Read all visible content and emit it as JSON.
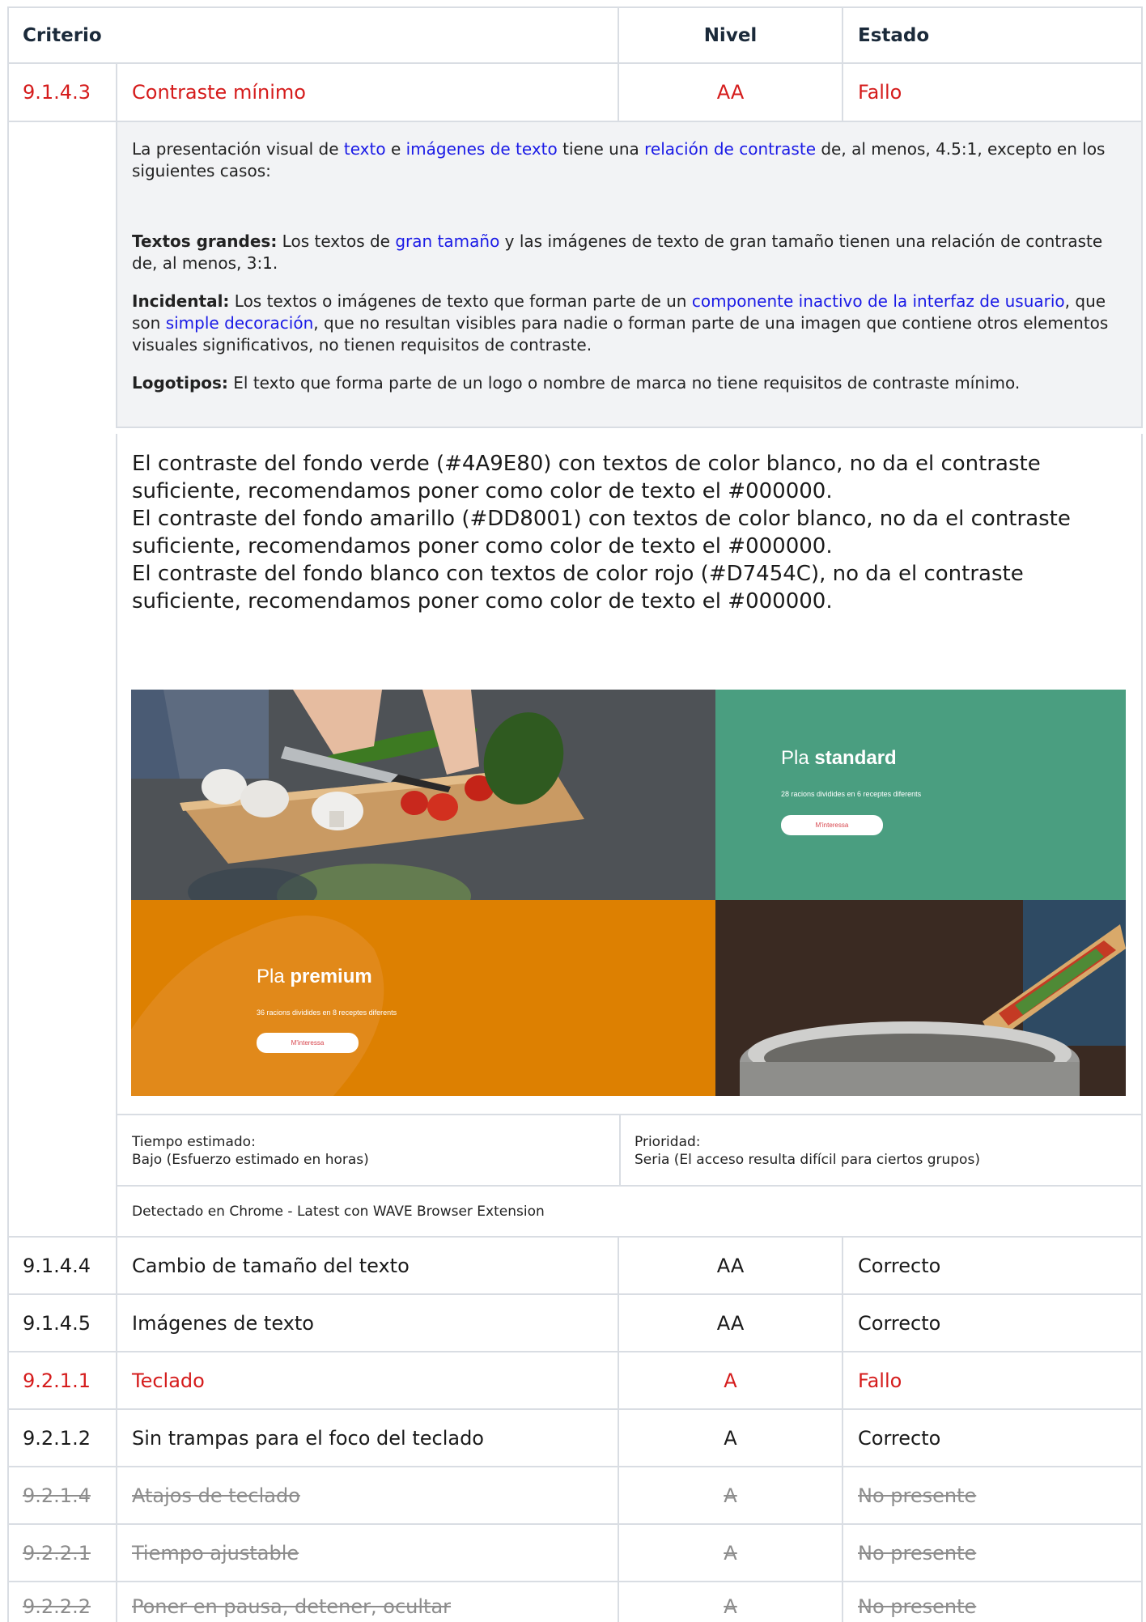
{
  "header": {
    "criterio": "Criterio",
    "nivel": "Nivel",
    "estado": "Estado"
  },
  "expanded": {
    "code": "9.1.4.3",
    "name": "Contraste mínimo",
    "level": "AA",
    "status": "Fallo",
    "description": {
      "p1_a": "La presentación visual de ",
      "p1_link1": "texto",
      "p1_b": " e ",
      "p1_link2": "imágenes de texto",
      "p1_c": " tiene una ",
      "p1_link3": "relación de contraste",
      "p1_d": " de, al menos, 4.5:1, excepto en los siguientes casos:",
      "large_label": "Textos grandes:",
      "large_a": " Los textos de ",
      "large_link": "gran tamaño",
      "large_b": " y las imágenes de texto de gran tamaño tienen una relación de contraste de, al menos, 3:1.",
      "incidental_label": "Incidental:",
      "incidental_a": " Los textos o imágenes de texto que forman parte de un ",
      "incidental_link1": "componente inactivo de la interfaz de usuario",
      "incidental_b": ", que son ",
      "incidental_link2": "simple decoración",
      "incidental_c": ", que no resultan visibles para nadie o forman parte de una imagen que contiene otros elementos visuales significativos, no tienen requisitos de contraste.",
      "logo_label": "Logotipos:",
      "logo_text": " El texto que forma parte de un logo o nombre de marca no tiene requisitos de contraste mínimo."
    },
    "comment": [
      "El contraste del fondo verde (#4A9E80) con textos de color blanco, no da el contraste suficiente, recomendamos poner como color de texto el #000000.",
      "El contraste del fondo amarillo (#DD8001) con textos de color blanco, no da el contraste suficiente, recomendamos poner como color de texto el #000000.",
      "El contraste del fondo blanco con textos de color rojo (#D7454C), no da el contraste suficiente, recomendamos poner como color de texto el #000000."
    ],
    "screenshot": {
      "standard_prefix": "Pla ",
      "standard_bold": "standard",
      "standard_sub": "28 racions dividides en 6 receptes diferents",
      "standard_btn": "M'interessa",
      "premium_prefix": "Pla ",
      "premium_bold": "premium",
      "premium_sub": "36 racions dividides en 8 receptes diferents",
      "premium_btn": "M'interessa",
      "colors": {
        "green": "#4A9E80",
        "orange": "#DD8001",
        "red": "#D7454C"
      }
    },
    "estimated_label": "Tiempo estimado:",
    "estimated_value": "Bajo (Esfuerzo estimado en horas)",
    "priority_label": "Prioridad:",
    "priority_value": "Seria (El acceso resulta difícil para ciertos grupos)",
    "detected": "Detectado en Chrome - Latest con WAVE Browser Extension"
  },
  "rows": [
    {
      "code": "9.1.4.4",
      "name": "Cambio de tamaño del texto",
      "level": "AA",
      "status": "Correcto"
    },
    {
      "code": "9.1.4.5",
      "name": "Imágenes de texto",
      "level": "AA",
      "status": "Correcto"
    },
    {
      "code": "9.2.1.1",
      "name": "Teclado",
      "level": "A",
      "status": "Fallo"
    },
    {
      "code": "9.2.1.2",
      "name": "Sin trampas para el foco del teclado",
      "level": "A",
      "status": "Correcto"
    },
    {
      "code": "9.2.1.4",
      "name": "Atajos de teclado",
      "level": "A",
      "status": "No presente"
    },
    {
      "code": "9.2.2.1",
      "name": "Tiempo ajustable",
      "level": "A",
      "status": "No presente"
    },
    {
      "code": "9.2.2.2",
      "name": "Poner en pausa, detener, ocultar",
      "level": "A",
      "status": "No presente"
    }
  ]
}
